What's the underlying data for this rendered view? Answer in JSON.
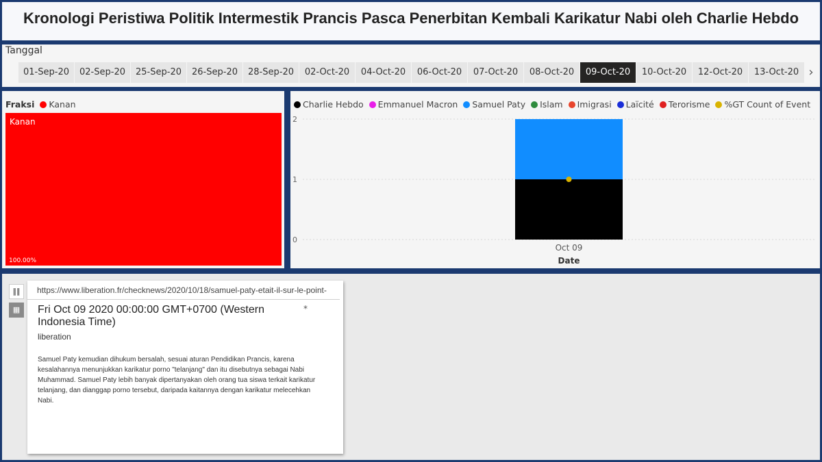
{
  "title": "Kronologi Peristiwa Politik Intermestik Prancis Pasca Penerbitan Kembali Karikatur Nabi oleh Charlie Hebdo",
  "slicer": {
    "label": "Tanggal",
    "dates": [
      "01-Sep-20",
      "02-Sep-20",
      "25-Sep-20",
      "26-Sep-20",
      "28-Sep-20",
      "02-Oct-20",
      "04-Oct-20",
      "06-Oct-20",
      "07-Oct-20",
      "08-Oct-20",
      "09-Oct-20",
      "10-Oct-20",
      "12-Oct-20",
      "13-Oct-20"
    ],
    "selected": "09-Oct-20",
    "next_icon": "chevron-right-icon"
  },
  "treemap": {
    "legend_title": "Fraksi",
    "legend_item": "Kanan",
    "legend_color": "#ff0000",
    "category_label": "Kanan",
    "percent_label": "100.00%"
  },
  "bar_legend": [
    {
      "name": "Charlie Hebdo",
      "color": "#000000"
    },
    {
      "name": "Emmanuel Macron",
      "color": "#e81ee8"
    },
    {
      "name": "Samuel Paty",
      "color": "#118dff"
    },
    {
      "name": "Islam",
      "color": "#2e8b3d"
    },
    {
      "name": "Imigrasi",
      "color": "#e8452c"
    },
    {
      "name": "Laïcité",
      "color": "#1a2ed8"
    },
    {
      "name": "Terorisme",
      "color": "#e02020"
    },
    {
      "name": "%GT Count of Event",
      "color": "#d9b300"
    }
  ],
  "chart_data": {
    "type": "bar",
    "stacked": true,
    "categories": [
      "Oct 09"
    ],
    "xlabel": "Date",
    "ylabel": "",
    "ylim": [
      0,
      2
    ],
    "yticks": [
      0,
      1,
      2
    ],
    "grid": true,
    "legend_position": "top-left",
    "series": [
      {
        "name": "Charlie Hebdo",
        "values": [
          1
        ],
        "color": "#000000"
      },
      {
        "name": "Samuel Paty",
        "values": [
          1
        ],
        "color": "#118dff"
      }
    ],
    "line_series": {
      "name": "%GT Count of Event",
      "values": [
        1
      ],
      "color": "#d9b300"
    }
  },
  "card": {
    "url": "https://www.liberation.fr/checknews/2020/10/18/samuel-paty-etait-il-sur-le-point-",
    "date": "Fri Oct 09 2020 00:00:00 GMT+0700 (Western Indonesia Time)",
    "pin_icon": "pin-icon",
    "source": "liberation",
    "body": "Samuel Paty kemudian dihukum bersalah, sesuai aturan Pendidikan Prancis, karena kesalahannya menunjukkan karikatur porno \"telanjang\" dan itu disebutnya sebagai Nabi Muhammad. Samuel Paty lebih banyak dipertanyakan oleh orang tua siswa terkait karikatur telanjang, dan dianggap porno tersebut, daripada kaitannya dengan karikatur melecehkan Nabi."
  },
  "side_buttons": {
    "list_icon": "list-view-icon",
    "grid_icon": "grid-view-icon"
  }
}
